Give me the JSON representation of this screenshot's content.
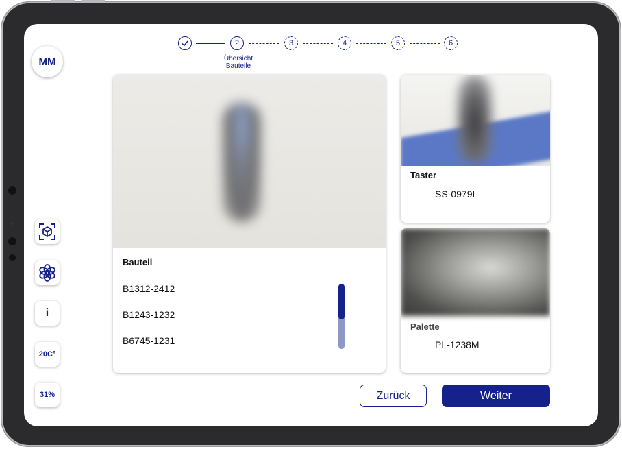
{
  "user": {
    "initials": "MM"
  },
  "stepper": {
    "steps": [
      {
        "label": "",
        "state": "done",
        "icon": "check-icon"
      },
      {
        "label": "2",
        "state": "active"
      },
      {
        "label": "3",
        "state": "todo"
      },
      {
        "label": "4",
        "state": "todo"
      },
      {
        "label": "5",
        "state": "todo"
      },
      {
        "label": "6",
        "state": "todo"
      }
    ],
    "active_caption_line1": "Übersicht",
    "active_caption_line2": "Bauteile"
  },
  "sidebar": {
    "buttons": [
      {
        "name": "scan-3d-button",
        "icon": "scan-cube-icon"
      },
      {
        "name": "ai-assistant-button",
        "icon": "ai-knot-icon"
      },
      {
        "name": "info-button",
        "label": "i",
        "icon": "info-icon"
      },
      {
        "name": "temperature-button",
        "label": "20C°"
      },
      {
        "name": "humidity-button",
        "label": "31%"
      }
    ]
  },
  "bauteil": {
    "title": "Bauteil",
    "items": [
      "B1312-2412",
      "B1243-1232",
      "B6745-1231"
    ]
  },
  "taster": {
    "title": "Taster",
    "value": "SS-0979L"
  },
  "palette": {
    "title": "Palette",
    "value": "PL-1238M"
  },
  "actions": {
    "back_label": "Zurück",
    "next_label": "Weiter"
  },
  "colors": {
    "accent": "#16228c",
    "scroll_track": "#8e98c6"
  }
}
